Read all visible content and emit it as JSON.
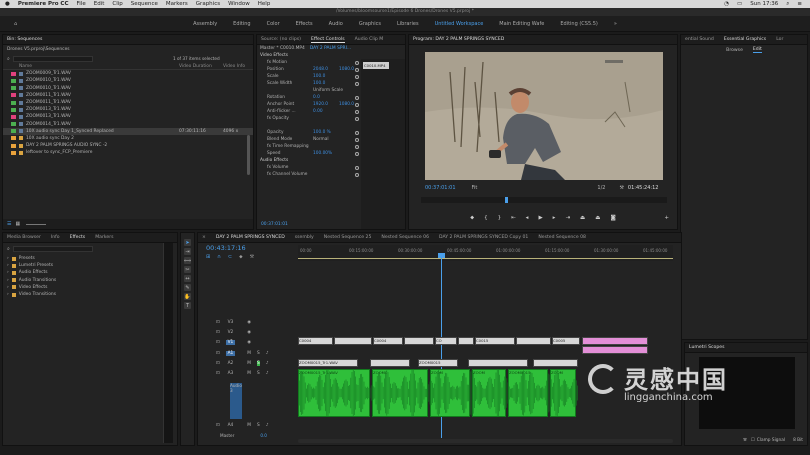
{
  "menubar": {
    "apple": "",
    "app": "Premiere Pro CC",
    "items": [
      "File",
      "Edit",
      "Clip",
      "Sequence",
      "Markers",
      "Graphics",
      "Window",
      "Help"
    ],
    "clock": "Sun 17:36"
  },
  "titlebar": {
    "path": "/Volumes/bloomsourse1/Episode 6 Drones/Drones V5.prproj *"
  },
  "workspaces": {
    "items": [
      "Assembly",
      "Editing",
      "Color",
      "Effects",
      "Audio",
      "Graphics",
      "Libraries",
      "Untitled Workspace",
      "Main Editing Wafe",
      "Editing (CS5.5)"
    ],
    "active": "Untitled Workspace",
    "more": "»"
  },
  "project": {
    "tab": "Bin: Sequences",
    "path": "Drones V5.prproj\\Sequences",
    "count": "1 of 37 items selected",
    "columns": {
      "name": "Name",
      "video_duration": "Video Duration",
      "video_info": "Video Info"
    },
    "items": [
      {
        "name": "ZOOM0009_Tr1.WAV",
        "color": "#e0417d",
        "dur": "",
        "info": ""
      },
      {
        "name": "ZOOM0010_Tr1.WAV",
        "color": "#4caf50",
        "dur": "",
        "info": ""
      },
      {
        "name": "ZOOM0010_Tr1.WAV",
        "color": "#4caf50",
        "dur": "",
        "info": ""
      },
      {
        "name": "ZOOM0011_Tr1.WAV",
        "color": "#e0417d",
        "dur": "",
        "info": ""
      },
      {
        "name": "ZOOM0011_Tr1.WAV",
        "color": "#4caf50",
        "dur": "",
        "info": ""
      },
      {
        "name": "ZOOM0013_Tr1.WAV",
        "color": "#4caf50",
        "dur": "",
        "info": ""
      },
      {
        "name": "ZOOM0013_Tr1.WAV",
        "color": "#e0417d",
        "dur": "",
        "info": ""
      },
      {
        "name": "ZOOM0014_Tr1.WAV",
        "color": "#4caf50",
        "dur": "",
        "info": ""
      },
      {
        "name": "10X audio sync Day 1_Synced Replaced",
        "color": "#4caf50",
        "dur": "07:30:11:16",
        "info": "4096 x"
      },
      {
        "name": "10X audio sync Day 2",
        "color": "#e8a23c",
        "dur": "",
        "info": ""
      },
      {
        "name": "DAY 2 PALM SPRINGS AUDIO SYNC -2",
        "color": "#e8a23c",
        "dur": "",
        "info": ""
      },
      {
        "name": "leftover to sync_FCP_Premiere",
        "color": "#e8a23c",
        "dur": "",
        "info": ""
      }
    ]
  },
  "effect_controls": {
    "tabs": [
      "Source: (no clips)",
      "Effect Controls",
      "Audio Clip M"
    ],
    "active": "Effect Controls",
    "master": "Master * C0010.MP4",
    "seq": "DAY 2 PALM SPRI...",
    "clip_label": "C0010.MP4",
    "rows": [
      {
        "label": "Video Effects",
        "v1": "",
        "v2": "",
        "section": true
      },
      {
        "label": "fx  Motion",
        "v1": "",
        "v2": ""
      },
      {
        "label": "Position",
        "v1": "2048.0",
        "v2": "1080.0"
      },
      {
        "label": "Scale",
        "v1": "100.0",
        "v2": ""
      },
      {
        "label": "Scale Width",
        "v1": "100.0",
        "v2": ""
      },
      {
        "label": "",
        "v1": "Uniform Scale",
        "v2": ""
      },
      {
        "label": "Rotation",
        "v1": "0.0",
        "v2": ""
      },
      {
        "label": "Anchor Point",
        "v1": "1920.0",
        "v2": "1080.0"
      },
      {
        "label": "Anti-flicker ...",
        "v1": "0.00",
        "v2": ""
      },
      {
        "label": "fx  Opacity",
        "v1": "",
        "v2": ""
      },
      {
        "label": "",
        "v1": "",
        "v2": ""
      },
      {
        "label": "Opacity",
        "v1": "100.0 %",
        "v2": ""
      },
      {
        "label": "Blend Mode",
        "v1": "Normal",
        "v2": ""
      },
      {
        "label": "fx  Time Remapping",
        "v1": "",
        "v2": ""
      },
      {
        "label": "Speed",
        "v1": "100.00%",
        "v2": ""
      },
      {
        "label": "Audio Effects",
        "v1": "",
        "v2": "",
        "section": true
      },
      {
        "label": "fx  Volume",
        "v1": "",
        "v2": ""
      },
      {
        "label": "fx  Channel Volume",
        "v1": "",
        "v2": ""
      }
    ],
    "timecode": "00:37:01:01"
  },
  "program": {
    "title": "Program: DAY 2 PALM SPRINGS SYNCED",
    "timecode": "00:37:01:01",
    "fit": "Fit",
    "quality": "1/2",
    "duration": "01:45:24:12"
  },
  "essential": {
    "tabs": [
      "ential Sound",
      "Essential Graphics",
      "Lor"
    ],
    "active": "Essential Graphics",
    "sub": [
      "Browse",
      "Edit"
    ],
    "sub_active": "Edit"
  },
  "effects_panel": {
    "tabs": [
      "Media Browser",
      "Info",
      "Effects",
      "Markers"
    ],
    "active": "Effects",
    "items": [
      "Presets",
      "Lumetri Presets",
      "Audio Effects",
      "Audio Transitions",
      "Video Effects",
      "Video Transitions"
    ]
  },
  "timeline": {
    "tabs": [
      "DAY 2 PALM SPRINGS SYNCED",
      "ssembly",
      "Nested Sequence 25",
      "Nested Sequence 06",
      "DAY 2 PALM SPRINGS SYNCED Copy 01",
      "Nested Sequence 08"
    ],
    "timecode": "00:43:17:16",
    "ruler": [
      "00:00",
      "00:15:00:00",
      "00:30:00:00",
      "00:45:00:00",
      "01:00:00:00",
      "01:15:00:00",
      "01:30:00:00",
      "01:45:00:00"
    ],
    "tracks": [
      "V3",
      "V2",
      "V1",
      "A1",
      "A2",
      "A3",
      "A4"
    ],
    "track_name_a3": "Audio 3",
    "master": "Master",
    "master_val": "0.0",
    "clips_v": [
      "C0004",
      "CO",
      "C0015",
      "C0005"
    ],
    "clips_a": [
      "ZOOM0015_Tr1.WAV",
      "ZOOM0",
      "ZOOM",
      "ZOOM",
      "ZOOM0015",
      "ZOOM"
    ]
  },
  "lumetri": {
    "title": "Lumetri Scopes",
    "clamp": "Clamp Signal",
    "bits": "8 Bit"
  },
  "watermark": {
    "cn": "灵感中国",
    "url": "lingganchina.com"
  }
}
